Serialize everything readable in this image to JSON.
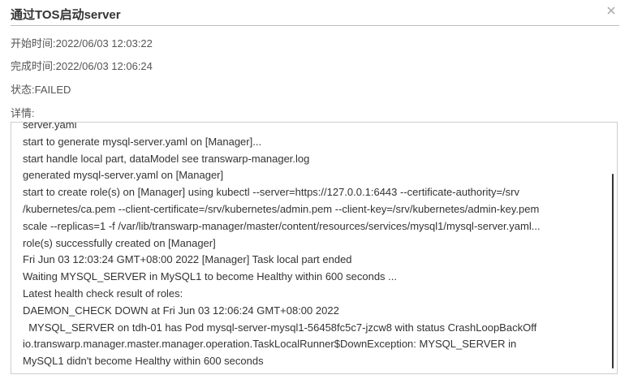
{
  "dialog": {
    "title": "通过TOS启动server",
    "close_icon": "close-icon"
  },
  "info": {
    "start_time": "开始时间:2022/06/03 12:03:22",
    "end_time": "完成时间:2022/06/03 12:06:24",
    "status": "状态:FAILED",
    "detail_label": "详情:"
  },
  "log": {
    "lines": [
      "server.yaml",
      "start to generate mysql-server.yaml on [Manager]...",
      "start handle local part, dataModel see transwarp-manager.log",
      "generated mysql-server.yaml on [Manager]",
      "start to create role(s) on [Manager] using kubectl --server=https://127.0.0.1:6443 --certificate-authority=/srv",
      "/kubernetes/ca.pem --client-certificate=/srv/kubernetes/admin.pem --client-key=/srv/kubernetes/admin-key.pem",
      "scale --replicas=1 -f /var/lib/transwarp-manager/master/content/resources/services/mysql1/mysql-server.yaml...",
      "role(s) successfully created on [Manager]",
      "Fri Jun 03 12:03:24 GMT+08:00 2022 [Manager] Task local part ended",
      "Waiting MYSQL_SERVER in MySQL1 to become Healthy within 600 seconds ...",
      "Latest health check result of roles:",
      "DAEMON_CHECK DOWN at Fri Jun 03 12:06:24 GMT+08:00 2022",
      "  MYSQL_SERVER on tdh-01 has Pod mysql-server-mysql1-56458fc5c7-jzcw8 with status CrashLoopBackOff",
      "io.transwarp.manager.master.manager.operation.TaskLocalRunner$DownException: MYSQL_SERVER in",
      "MySQL1 didn't become Healthy within 600 seconds"
    ]
  }
}
